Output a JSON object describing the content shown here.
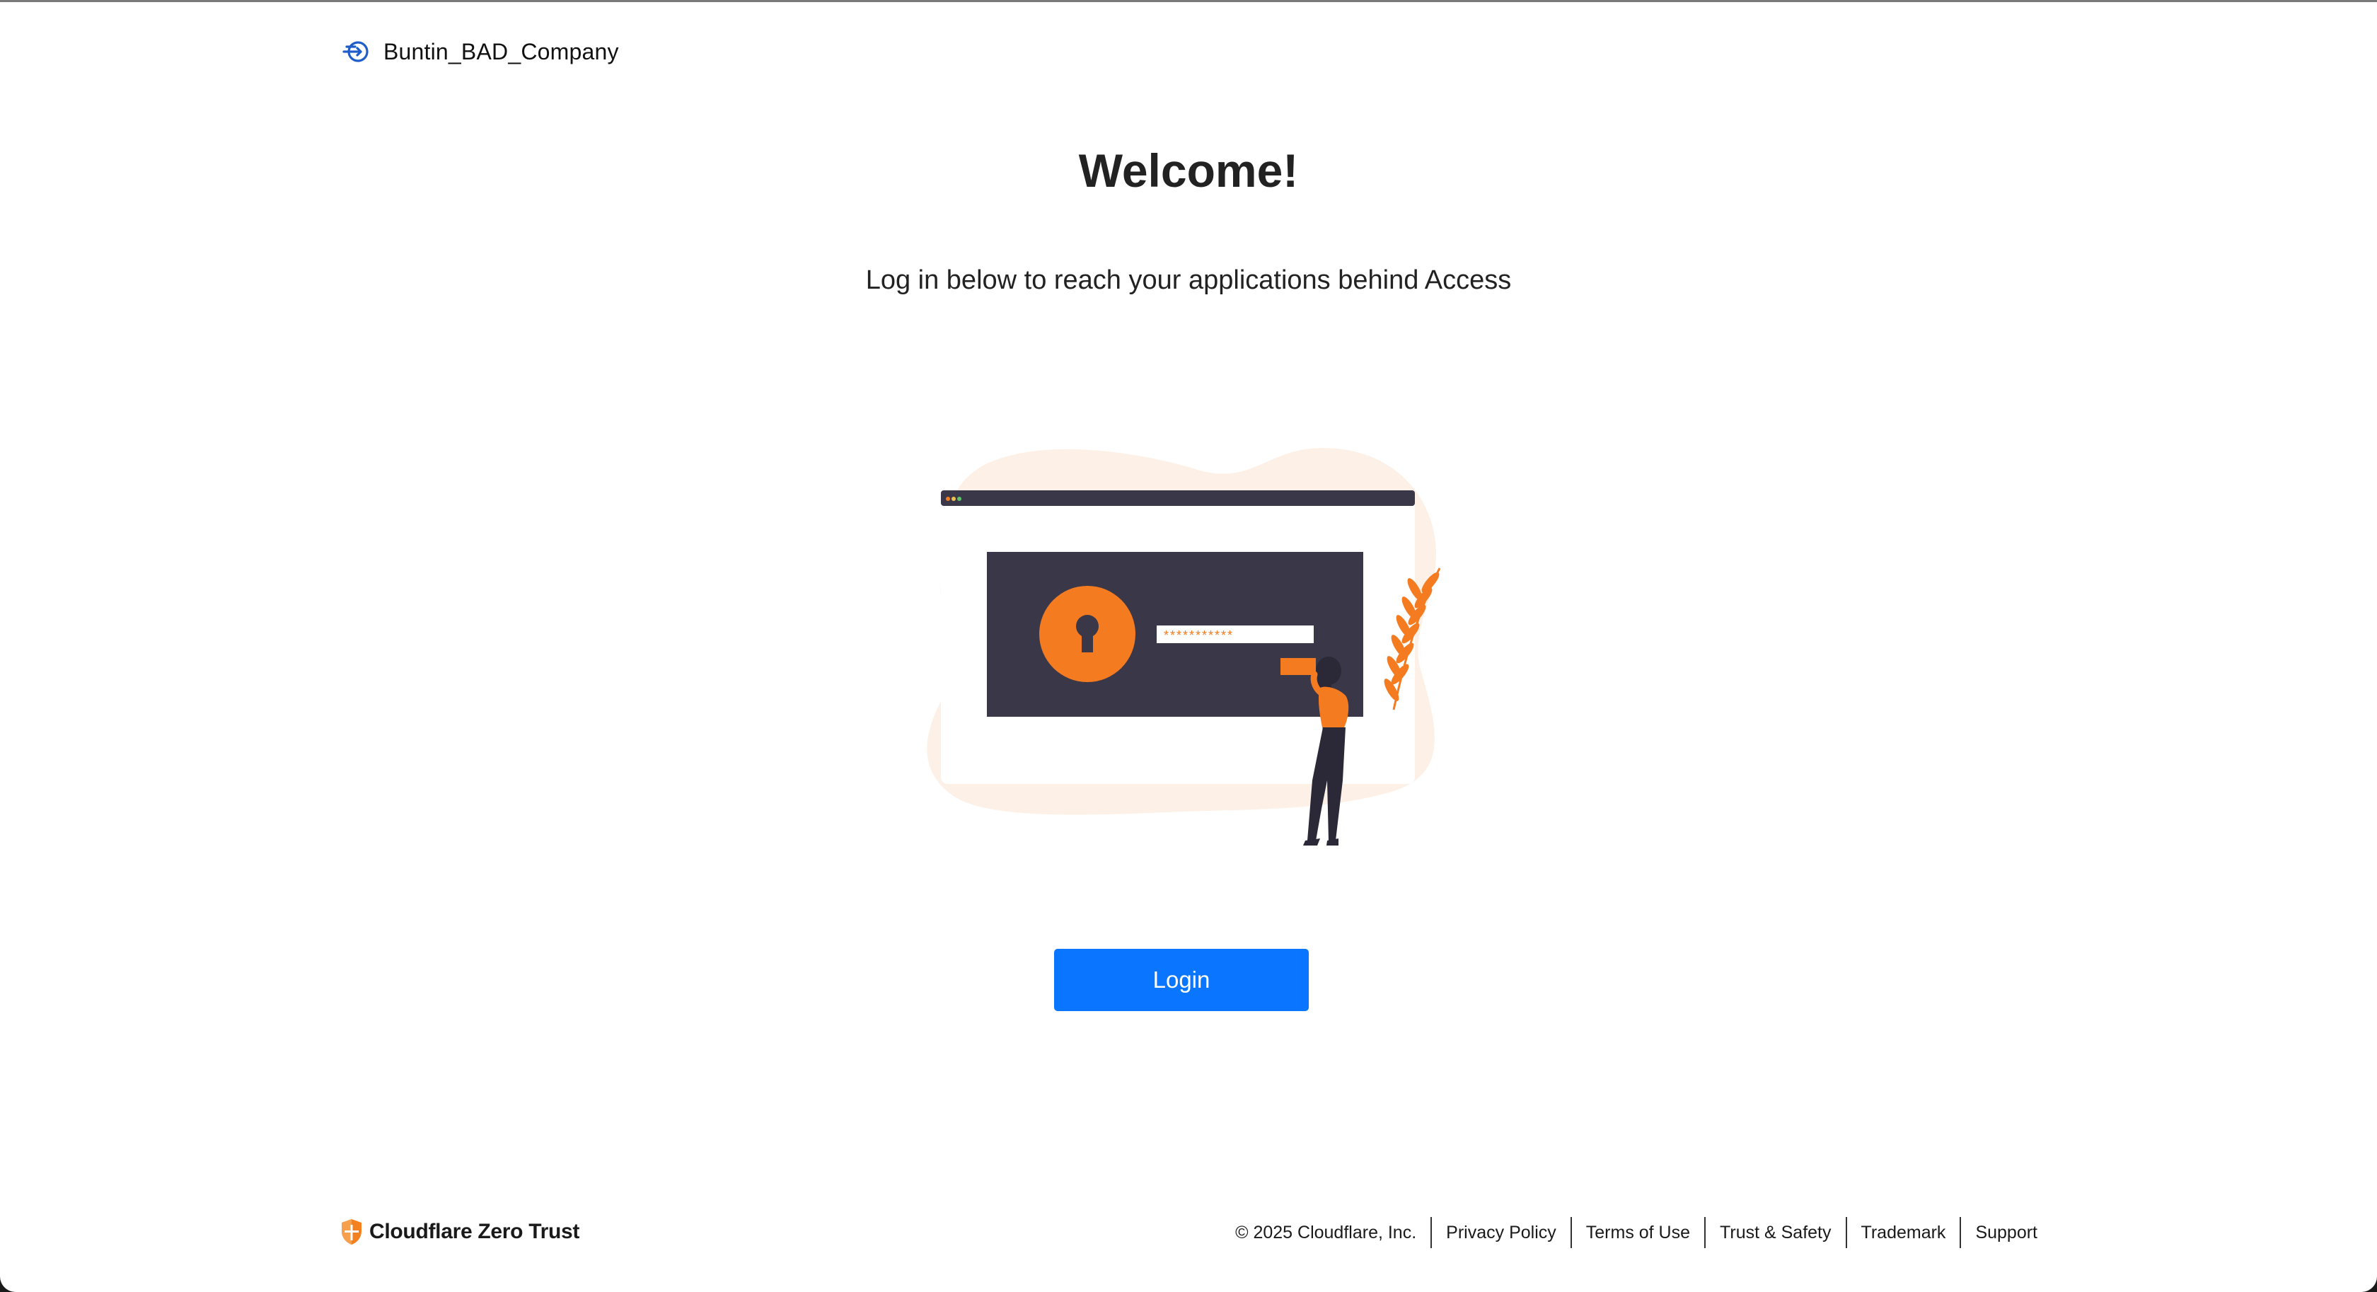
{
  "brand": {
    "name": "Buntin_BAD_Company",
    "icon": "team-arrow-icon",
    "color": "#1f5ec9"
  },
  "main": {
    "title": "Welcome!",
    "subtitle": "Log in below to reach your applications behind Access",
    "illustration_password_mask": "***********",
    "login_label": "Login"
  },
  "footer": {
    "brand_text": "Cloudflare Zero Trust",
    "brand_icon": "cloudflare-shield-icon",
    "copyright": "© 2025 Cloudflare, Inc.",
    "links": [
      {
        "label": "Privacy Policy"
      },
      {
        "label": "Terms of Use"
      },
      {
        "label": "Trust & Safety"
      },
      {
        "label": "Trademark"
      },
      {
        "label": "Support"
      }
    ]
  },
  "colors": {
    "accent": "#0a76ff",
    "illustration_orange": "#f47b20",
    "illustration_dark": "#3a3748",
    "blob": "#fdf1e7"
  }
}
